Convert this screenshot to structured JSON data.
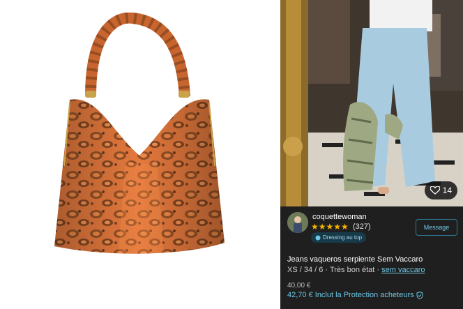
{
  "seller": {
    "username": "coquettewoman",
    "stars": "★★★★★",
    "rating_count": "(327)",
    "badge": "Dressing au top",
    "message_button": "Message"
  },
  "photo": {
    "likes": "14"
  },
  "item": {
    "title": "Jeans vaqueros serpiente Sem Vaccaro",
    "meta_prefix": "XS / 34 / 6 · Très bon état · ",
    "brand_link": "sem vaccaro",
    "price": "40,00 €",
    "price_with_protection": "42,70 € Inclut la Protection acheteurs"
  },
  "colors": {
    "accent": "#6ec7e6",
    "stars": "#f5b400",
    "bag": "#e0743a",
    "panel": "#1f1f1f"
  }
}
